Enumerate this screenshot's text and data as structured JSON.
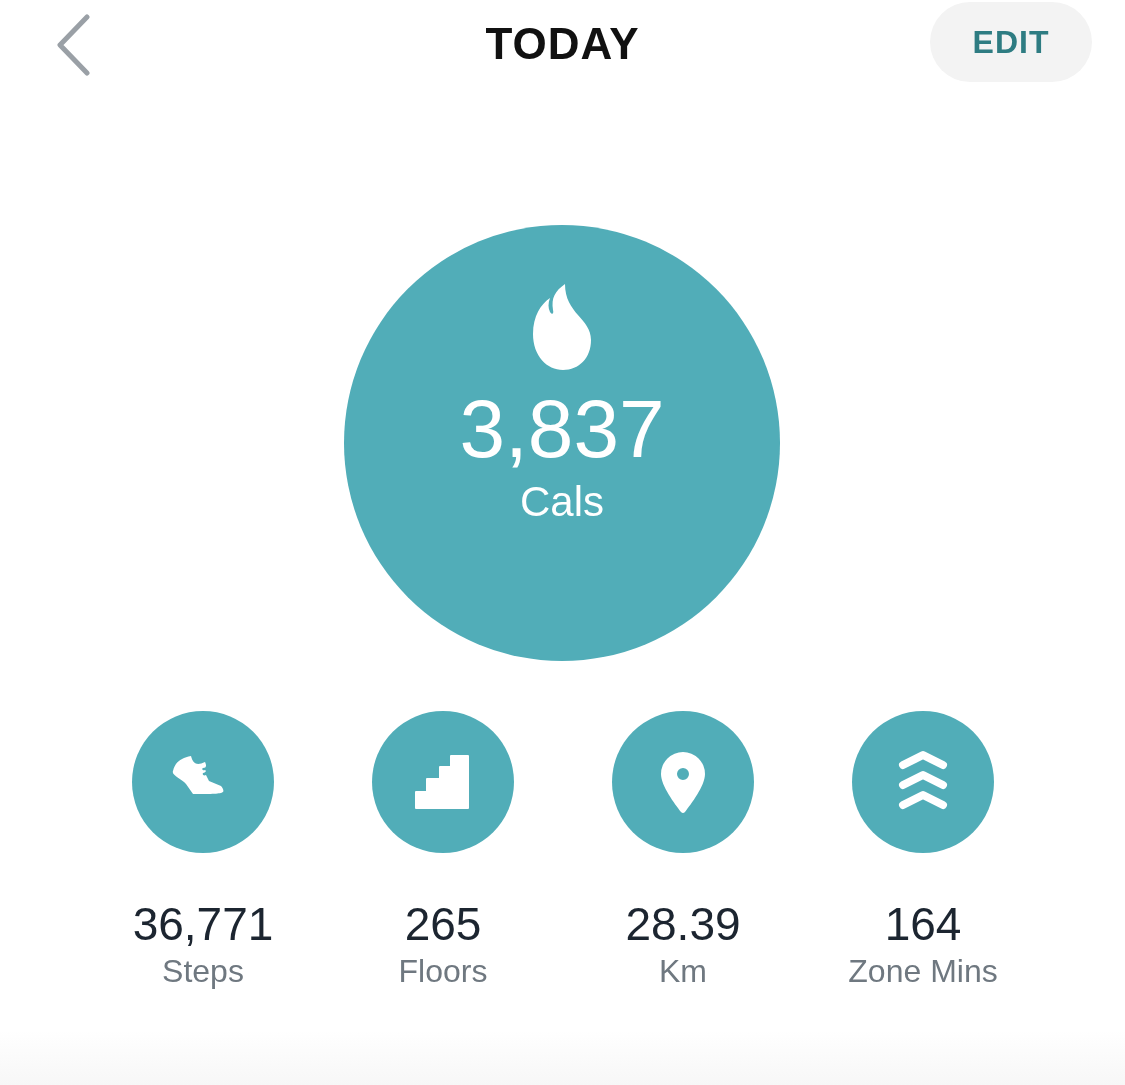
{
  "header": {
    "title": "TODAY",
    "edit_button": "EDIT"
  },
  "main_stat": {
    "value": "3,837",
    "unit": "Cals"
  },
  "stats": [
    {
      "kind": "steps",
      "value": "36,771",
      "label": "Steps"
    },
    {
      "kind": "floors",
      "value": "265",
      "label": "Floors"
    },
    {
      "kind": "distance",
      "value": "28.39",
      "label": "Km"
    },
    {
      "kind": "zone",
      "value": "164",
      "label": "Zone Mins"
    }
  ]
}
